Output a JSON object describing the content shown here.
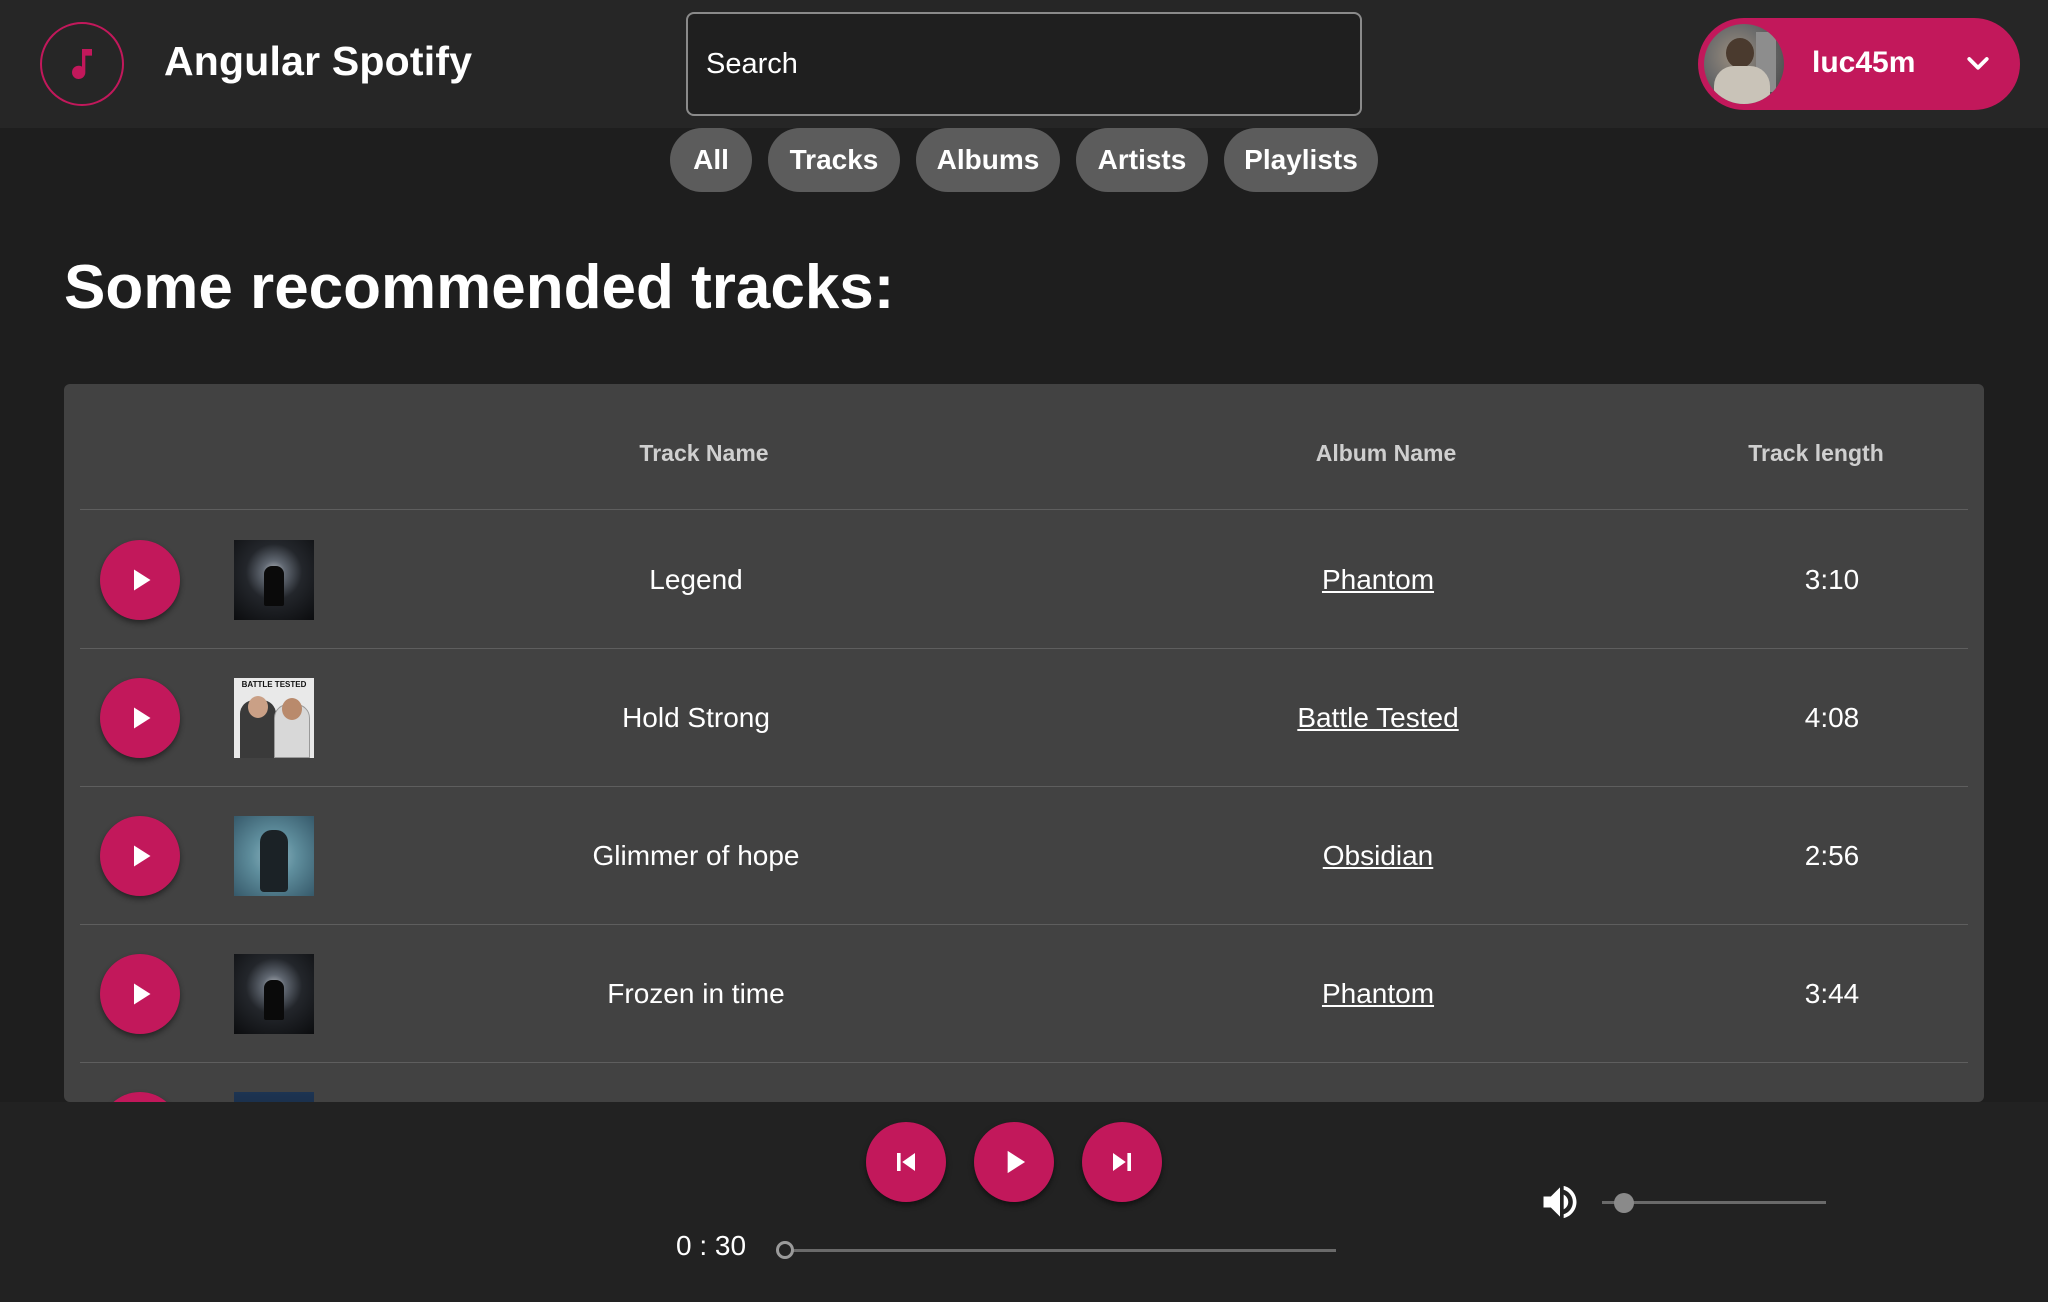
{
  "app": {
    "title": "Angular Spotify",
    "accent_color": "#c2185b",
    "logo_icon": "music-note-icon"
  },
  "search": {
    "placeholder": "Search",
    "value": ""
  },
  "user": {
    "name": "luc45m",
    "menu_icon": "chevron-down-icon"
  },
  "filters": [
    {
      "label": "All"
    },
    {
      "label": "Tracks"
    },
    {
      "label": "Albums"
    },
    {
      "label": "Artists"
    },
    {
      "label": "Playlists"
    }
  ],
  "main": {
    "heading": "Some recommended tracks:"
  },
  "table": {
    "columns": [
      "Track Name",
      "Album Name",
      "Track length"
    ],
    "rows": [
      {
        "track": "Legend",
        "album": "Phantom",
        "length": "3:10",
        "cover": "phantom"
      },
      {
        "track": "Hold Strong",
        "album": "Battle Tested",
        "length": "4:08",
        "cover": "battle-tested"
      },
      {
        "track": "Glimmer of hope",
        "album": "Obsidian",
        "length": "2:56",
        "cover": "obsidian"
      },
      {
        "track": "Frozen in time",
        "album": "Phantom",
        "length": "3:44",
        "cover": "phantom"
      }
    ],
    "battle_tested_cover_text": "BATTLE TESTED"
  },
  "player": {
    "current_time": "0 : 30",
    "progress": 0.0,
    "volume": 0.05,
    "controls": [
      "skip-previous-icon",
      "play-icon",
      "skip-next-icon"
    ],
    "volume_icon": "volume-up-icon"
  }
}
